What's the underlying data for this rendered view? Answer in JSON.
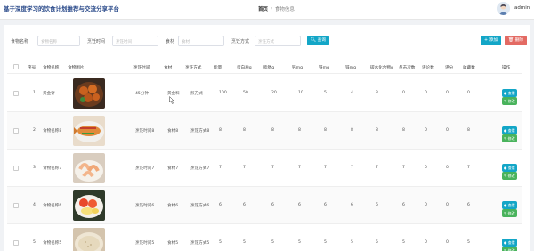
{
  "header": {
    "app_title": "基于深度学习的饮食计划推荐与交流分享平台",
    "breadcrumb_home": "首页",
    "breadcrumb_sep": "/",
    "breadcrumb_current": "食物信息",
    "username": "admin"
  },
  "search": {
    "fields": [
      {
        "label": "食物名称",
        "placeholder": "食物名称"
      },
      {
        "label": "烹饪时间",
        "placeholder": "烹饪时间"
      },
      {
        "label": "食材",
        "placeholder": "食材"
      },
      {
        "label": "烹饪方式",
        "placeholder": "烹饪方式"
      }
    ],
    "query_label": "查询",
    "add_label": "+ 添加",
    "delete_label": "删除"
  },
  "table": {
    "columns": [
      "序号",
      "食物名称",
      "食物图片",
      "烹饪时间",
      "食材",
      "烹饪方式",
      "能量",
      "蛋白质g",
      "脂肪g",
      "钙mg",
      "铁mg",
      "锌mg",
      "碳水化合物g",
      "点击次数",
      "评论数",
      "评分",
      "收藏数",
      "操作"
    ],
    "rows": [
      {
        "index": "1",
        "name": "黄金饼",
        "time": "45分钟",
        "ingredient": "黄金料",
        "method": "煎方式",
        "energy": "100",
        "protein": "50",
        "fat": "20",
        "calcium": "10",
        "iron": "5",
        "zinc": "4",
        "carbs": "3",
        "clicks": "0",
        "comments": "0",
        "score": "0",
        "favorites": "0",
        "image": "meatballs"
      },
      {
        "index": "2",
        "name": "食物名称8",
        "time": "烹饪时间8",
        "ingredient": "食材8",
        "method": "烹饪方式8",
        "energy": "8",
        "protein": "8",
        "fat": "8",
        "calcium": "8",
        "iron": "8",
        "zinc": "8",
        "carbs": "8",
        "clicks": "8",
        "comments": "0",
        "score": "0",
        "favorites": "8",
        "image": "fish"
      },
      {
        "index": "3",
        "name": "食物名称7",
        "time": "烹饪时间7",
        "ingredient": "食材7",
        "method": "烹饪方式7",
        "energy": "7",
        "protein": "7",
        "fat": "7",
        "calcium": "7",
        "iron": "7",
        "zinc": "7",
        "carbs": "7",
        "clicks": "7",
        "comments": "0",
        "score": "0",
        "favorites": "7",
        "image": "shrimp"
      },
      {
        "index": "4",
        "name": "食物名称6",
        "time": "烹饪时间6",
        "ingredient": "食材6",
        "method": "烹饪方式6",
        "energy": "6",
        "protein": "6",
        "fat": "6",
        "calcium": "6",
        "iron": "6",
        "zinc": "6",
        "carbs": "6",
        "clicks": "6",
        "comments": "0",
        "score": "0",
        "favorites": "6",
        "image": "tomato"
      },
      {
        "index": "5",
        "name": "食物名称5",
        "time": "烹饪时间5",
        "ingredient": "食材5",
        "method": "烹饪方式5",
        "energy": "5",
        "protein": "5",
        "fat": "5",
        "calcium": "5",
        "iron": "5",
        "zinc": "5",
        "carbs": "5",
        "clicks": "5",
        "comments": "0",
        "score": "0",
        "favorites": "5",
        "image": "rice"
      }
    ],
    "view_label": "查看",
    "edit_label": "修改"
  },
  "colors": {
    "primary": "#13a6c7",
    "danger": "#e36a63",
    "success": "#49b35c",
    "title": "#2a4a8a"
  }
}
